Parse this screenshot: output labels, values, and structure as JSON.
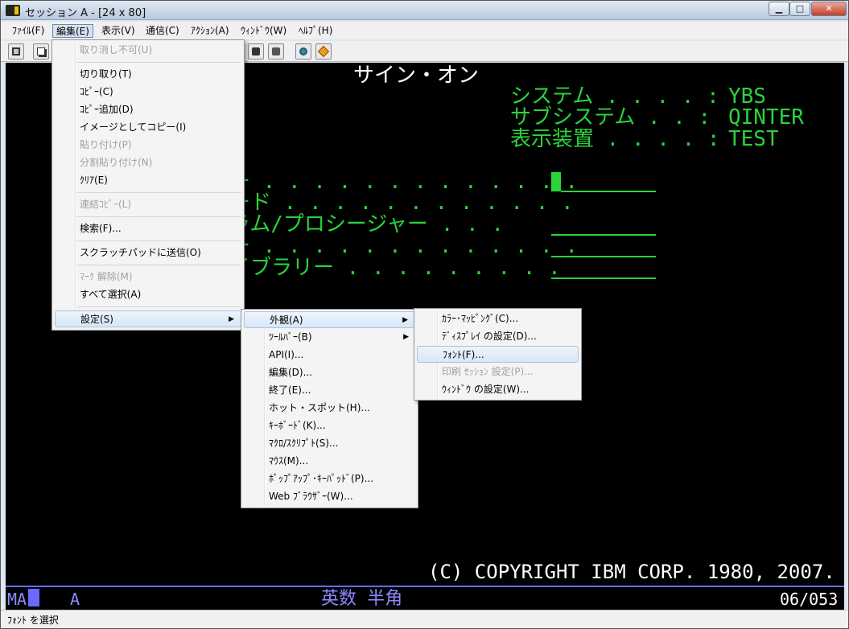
{
  "window": {
    "title": "セッション A - [24 x 80]",
    "buttons": {
      "minimize": "▁",
      "maximize": "□",
      "close": "✕"
    }
  },
  "menubar": [
    "ﾌｧｲﾙ(F)",
    "編集(E)",
    "表示(V)",
    "通信(C)",
    "ｱｸｼｮﾝ(A)",
    "ｳｨﾝﾄﾞｳ(W)",
    "ﾍﾙﾌﾟ(H)"
  ],
  "edit_menu": {
    "undo": "取り消し不可(U)",
    "cut": "切り取り(T)",
    "copy": "ｺﾋﾟｰ(C)",
    "copy_append": "ｺﾋﾟｰ追加(D)",
    "copy_image": "イメージとしてコピー(I)",
    "paste": "貼り付け(P)",
    "paste_split": "分割貼り付け(N)",
    "clear": "ｸﾘｱ(E)",
    "linked_copy": "連結ｺﾋﾟｰ(L)",
    "find": "検索(F)...",
    "scratchpad": "スクラッチパッドに送信(O)",
    "unmark": "ﾏｰｸ 解除(M)",
    "select_all": "すべて選択(A)",
    "settings": "設定(S)"
  },
  "settings_menu": {
    "appearance": "外観(A)",
    "toolbar": "ﾂｰﾙﾊﾞｰ(B)",
    "api": "API(I)...",
    "edit": "編集(D)...",
    "exit": "終了(E)...",
    "hotspot": "ホット・スポット(H)...",
    "keyboard": "ｷｰﾎﾞｰﾄﾞ(K)...",
    "macro": "ﾏｸﾛ/ｽｸﾘﾌﾟﾄ(S)...",
    "mouse": "ﾏｳｽ(M)...",
    "popup_keypad": "ﾎﾟｯﾌﾟｱｯﾌﾟ･ｷｰﾊﾟｯﾄﾞ(P)...",
    "web_browser": "Web ﾌﾞﾗｳｻﾞｰ(W)..."
  },
  "appearance_menu": {
    "color_mapping": "ｶﾗｰ･ﾏｯﾋﾟﾝｸﾞ(C)...",
    "display_settings": "ﾃﾞｨｽﾌﾟﾚｲ の設定(D)...",
    "font": "ﾌｫﾝﾄ(F)...",
    "print_session": "印刷 ｾｯｼｮﾝ 設定(P)...",
    "window_settings": "ｳｨﾝﾄﾞｳ の設定(W)..."
  },
  "terminal": {
    "heading": "サイン・オン",
    "system_label": "システム . . . . :",
    "system_value": "YBS",
    "subsystem_label": "サブシステム . . :",
    "subsystem_value": "QINTER",
    "display_label": "表示装置 . . . . :",
    "display_value": "TEST",
    "row1": "ー . . . . . . . . . . . . .",
    "row2": "ード . . . . . . . . . . . .",
    "row3": "ラム/プロシージャー . . .",
    "row4": "ー . . . . . . . . . . . . .",
    "row5": "イブラリー . . . . . . . . .",
    "copyright": "(C) COPYRIGHT IBM CORP. 1980, 2007."
  },
  "oia": {
    "indicator": "MA",
    "session": "A",
    "input_mode": "英数 半角",
    "position": "06/053"
  },
  "status_bar": "ﾌｫﾝﾄ を選択",
  "colors": {
    "terminal_green": "#29d43b",
    "terminal_white": "#ffffff",
    "oia_blue": "#8a8aff",
    "menu_highlight": "#d7e6f7"
  }
}
